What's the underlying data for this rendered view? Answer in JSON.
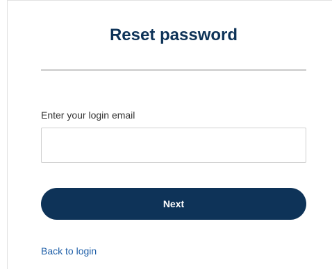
{
  "form": {
    "title": "Reset password",
    "email_label": "Enter your login email",
    "email_value": "",
    "email_placeholder": "",
    "next_label": "Next",
    "back_link_label": "Back to login"
  },
  "colors": {
    "brand": "#0e3358",
    "link": "#1f5fa8",
    "divider": "#c9c9c9"
  }
}
